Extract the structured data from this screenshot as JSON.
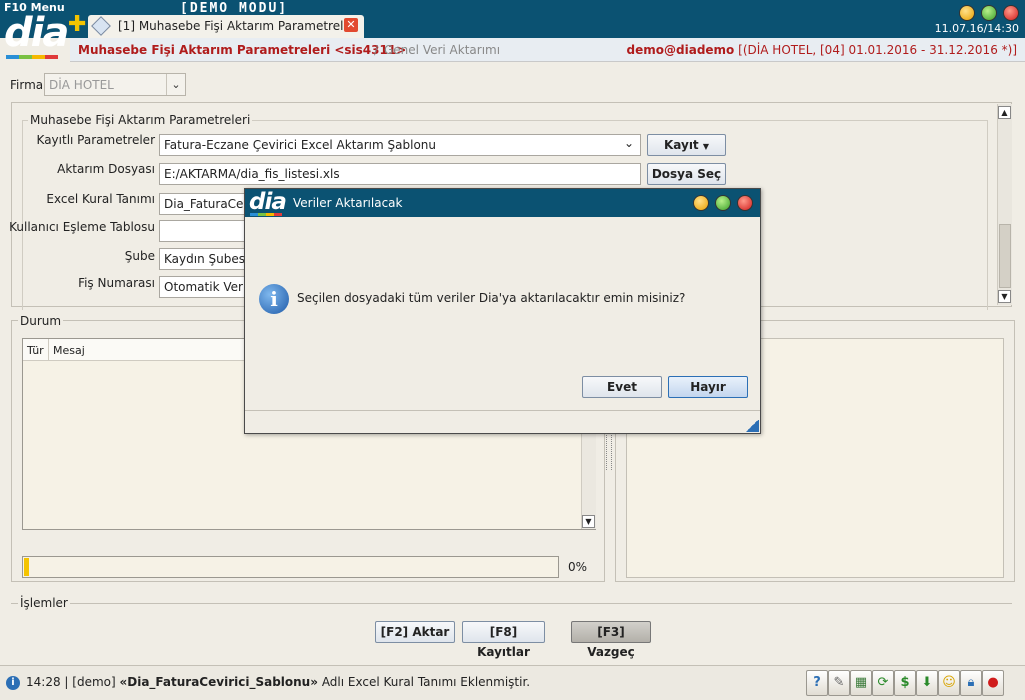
{
  "topbar": {
    "menu_label": "F10 Menu",
    "logo_text": "dia",
    "demo_banner": "[DEMO MODU]",
    "tab_label": "[1] Muhasebe Fişi Aktarım Parametreleri",
    "datetime": "11.07.16/14:30"
  },
  "breadcrumb": {
    "title": "Muhasebe Fişi Aktarım Parametreleri <sis4311>",
    "separator": "/",
    "subtitle": "Genel Veri Aktarımı",
    "user": "demo@diademo",
    "context": "[(DİA HOTEL, [04] 01.01.2016 - 31.12.2016 *)]"
  },
  "firma": {
    "label": "Firma",
    "value": "DİA HOTEL"
  },
  "params": {
    "legend": "Muhasebe Fişi Aktarım Parametreleri",
    "fields": [
      {
        "label": "Kayıtlı Parametreler",
        "value": "Fatura-Eczane Çevirici Excel Aktarım Şablonu"
      },
      {
        "label": "Aktarım Dosyası",
        "value": "E:/AKTARMA/dia_fis_listesi.xls"
      },
      {
        "label": "Excel Kural Tanımı",
        "value": "Dia_FaturaCevirici_Sablonu"
      },
      {
        "label": "Kullanıcı Eşleme Tablosu",
        "value": ""
      },
      {
        "label": "Şube",
        "value": "Kaydın Şubesi"
      },
      {
        "label": "Fiş Numarası",
        "value": "Otomatik Verilsin"
      }
    ],
    "kayit_button": "Kayıt",
    "dosya_sec_button": "Dosya Seç"
  },
  "durum": {
    "legend": "Durum",
    "col_tur": "Tür",
    "col_mesaj": "Mesaj",
    "progress_pct": "0%",
    "progress_value": 0.01
  },
  "islemler": {
    "legend": "İşlemler",
    "aktar_button": "[F2] Aktar",
    "kayitlar_button": "[F8] Kayıtlar",
    "vazgec_button": "[F3] Vazgeç"
  },
  "status": {
    "time": "14:28",
    "user": "[demo]",
    "rule": "«Dia_FaturaCevirici_Sablonu»",
    "message": "Adlı Excel Kural Tanımı Eklenmiştir."
  },
  "dialog": {
    "logo_text": "dia",
    "title": "Veriler Aktarılacak",
    "message": "Seçilen dosyadaki tüm veriler Dia'ya aktarılacaktır emin misiniz?",
    "yes_button": "Evet",
    "no_button": "Hayır"
  },
  "colors": {
    "header_bg": "#0b5272",
    "title_red": "#b01c1c",
    "progress_yellow": "#f5c400"
  },
  "icons": [
    "info-icon",
    "help-icon",
    "wrench-icon",
    "calculator-icon",
    "refresh-icon",
    "dollar-icon",
    "download-icon",
    "smiley-icon",
    "lock-icon",
    "stop-icon"
  ]
}
